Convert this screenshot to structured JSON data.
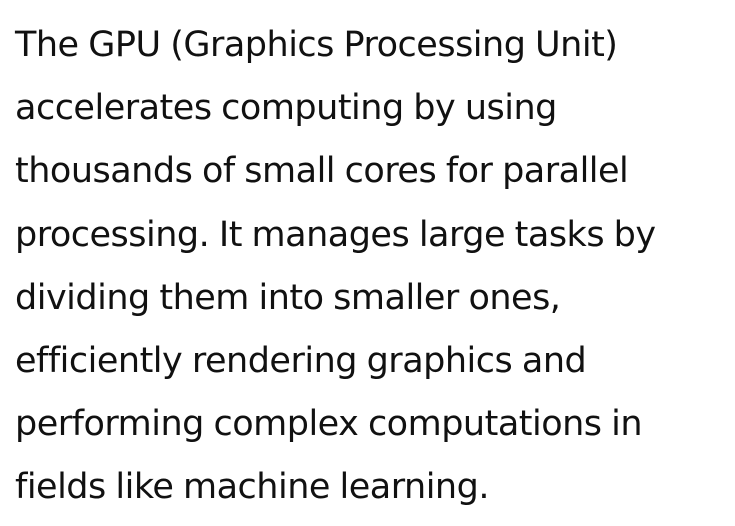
{
  "paragraph": {
    "lines": [
      "The GPU (Graphics Processing Unit)",
      "accelerates computing by using",
      "thousands of small cores for parallel",
      "processing. It manages large tasks by",
      "dividing them into smaller ones,",
      "efficiently rendering graphics and",
      "performing complex computations in",
      "fields like machine learning."
    ]
  }
}
